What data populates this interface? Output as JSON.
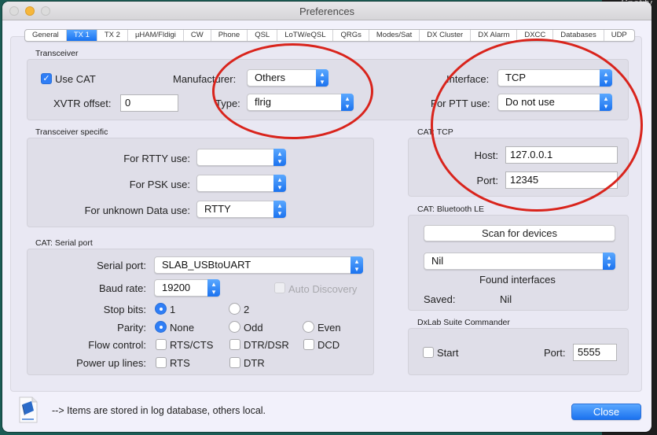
{
  "desktop": {
    "corner_text": "Spotify"
  },
  "window": {
    "title": "Preferences"
  },
  "tabs": [
    {
      "label": "General",
      "active": false
    },
    {
      "label": "TX 1",
      "active": true
    },
    {
      "label": "TX 2",
      "active": false
    },
    {
      "label": "µHAM/Fldigi",
      "active": false
    },
    {
      "label": "CW",
      "active": false
    },
    {
      "label": "Phone",
      "active": false
    },
    {
      "label": "QSL",
      "active": false
    },
    {
      "label": "LoTW/eQSL",
      "active": false
    },
    {
      "label": "QRGs",
      "active": false
    },
    {
      "label": "Modes/Sat",
      "active": false
    },
    {
      "label": "DX Cluster",
      "active": false
    },
    {
      "label": "DX Alarm",
      "active": false
    },
    {
      "label": "DXCC",
      "active": false
    },
    {
      "label": "Databases",
      "active": false
    },
    {
      "label": "UDP",
      "active": false
    }
  ],
  "transceiver": {
    "group_label": "Transceiver",
    "use_cat_label": "Use CAT",
    "use_cat_checked": true,
    "manufacturer_label": "Manufacturer:",
    "manufacturer_value": "Others",
    "xvtr_label": "XVTR offset:",
    "xvtr_value": "0",
    "type_label": "Type:",
    "type_value": "flrig",
    "interface_label": "Interface:",
    "interface_value": "TCP",
    "ptt_label": "For PTT use:",
    "ptt_value": "Do not use"
  },
  "transceiver_specific": {
    "group_label": "Transceiver specific",
    "rtty_label": "For RTTY use:",
    "rtty_value": "",
    "psk_label": "For PSK use:",
    "psk_value": "",
    "unknown_label": "For unknown Data use:",
    "unknown_value": "RTTY"
  },
  "cat_tcp": {
    "group_label": "CAT: TCP",
    "host_label": "Host:",
    "host_value": "127.0.0.1",
    "port_label": "Port:",
    "port_value": "12345"
  },
  "cat_serial": {
    "group_label": "CAT: Serial port",
    "serial_port_label": "Serial port:",
    "serial_port_value": "SLAB_USBtoUART",
    "baud_label": "Baud rate:",
    "baud_value": "19200",
    "auto_discovery_label": "Auto Discovery",
    "stop_bits_label": "Stop bits:",
    "stop_bits_options": [
      "1",
      "2"
    ],
    "stop_bits_selected": "1",
    "parity_label": "Parity:",
    "parity_options": [
      "None",
      "Odd",
      "Even"
    ],
    "parity_selected": "None",
    "flow_label": "Flow control:",
    "flow_options": [
      "RTS/CTS",
      "DTR/DSR",
      "DCD"
    ],
    "power_label": "Power up lines:",
    "power_options": [
      "RTS",
      "DTR"
    ]
  },
  "cat_bluetooth": {
    "group_label": "CAT: Bluetooth LE",
    "scan_button": "Scan for devices",
    "device_value": "Nil",
    "found_label": "Found interfaces",
    "saved_label": "Saved:",
    "saved_value": "Nil"
  },
  "dxlab": {
    "group_label": "DxLab Suite Commander",
    "start_label": "Start",
    "port_label": "Port:",
    "port_value": "5555"
  },
  "footer": {
    "note": "--> Items are stored in log database, others local.",
    "close_button": "Close"
  }
}
